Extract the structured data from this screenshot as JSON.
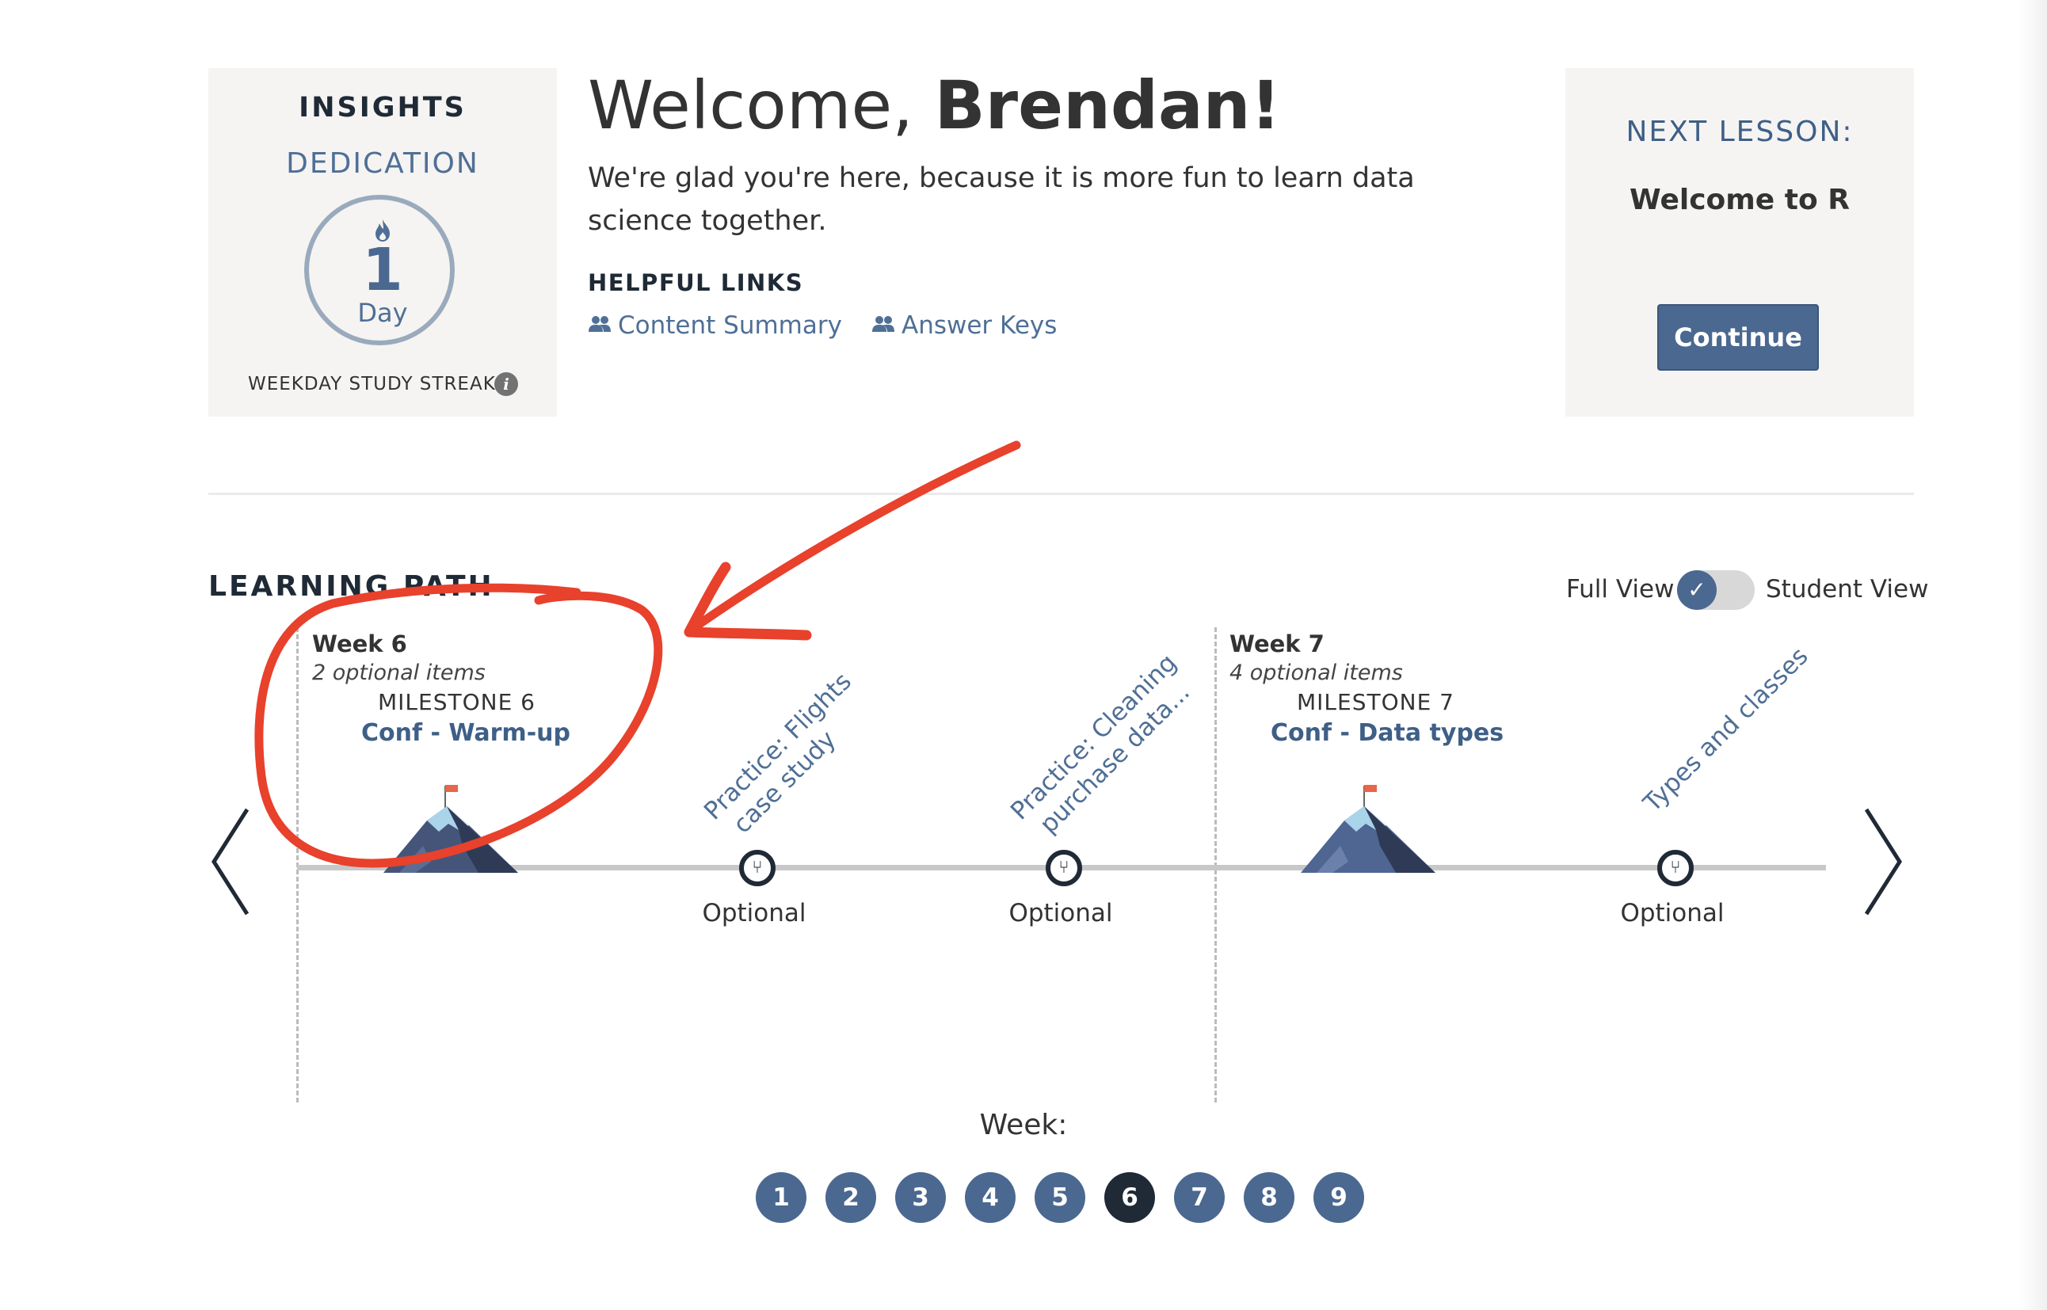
{
  "insights": {
    "title": "INSIGHTS",
    "dedication_label": "DEDICATION",
    "streak_icon": "flame-icon",
    "streak_number": "1",
    "streak_unit": "Day",
    "streak_caption": "WEEKDAY STUDY STREAK",
    "info_icon": "i"
  },
  "welcome": {
    "greeting": "Welcome, ",
    "name": "Brendan!",
    "subtitle": "We're glad you're here, because it is more fun to learn data science together."
  },
  "helpful_links": {
    "title": "HELPFUL LINKS",
    "links": [
      {
        "label": "Content Summary",
        "icon": "users-icon"
      },
      {
        "label": "Answer Keys",
        "icon": "users-icon"
      }
    ]
  },
  "next_lesson": {
    "title": "NEXT LESSON:",
    "name": "Welcome to R",
    "button": "Continue"
  },
  "learning_path": {
    "title": "LEARNING PATH",
    "full_view_label": "Full View",
    "student_view_label": "Student View",
    "toggle_checked": true,
    "weeks": [
      {
        "title": "Week 6",
        "optional": "2 optional items",
        "milestone_label": "MILESTONE 6",
        "milestone_name": "Conf - Warm-up"
      },
      {
        "title": "Week 7",
        "optional": "4 optional items",
        "milestone_label": "MILESTONE 7",
        "milestone_name": "Conf - Data types"
      }
    ],
    "items": [
      {
        "title_line1": "Practice: Flights",
        "title_line2": "case study",
        "label": "Optional"
      },
      {
        "title_line1": "Practice: Cleaning",
        "title_line2": "purchase data...",
        "label": "Optional"
      },
      {
        "title_line1": "Types and classes",
        "title_line2": "",
        "label": "Optional"
      }
    ],
    "prev_arrow": "〈",
    "next_arrow": "〉"
  },
  "week_pager": {
    "label": "Week:",
    "pages": [
      "1",
      "2",
      "3",
      "4",
      "5",
      "6",
      "7",
      "8",
      "9"
    ],
    "active": "6"
  },
  "annotation": {
    "color": "#e8412c"
  },
  "colors": {
    "accent": "#4a6890",
    "dark": "#1f2a36",
    "panel": "#f5f4f2"
  }
}
